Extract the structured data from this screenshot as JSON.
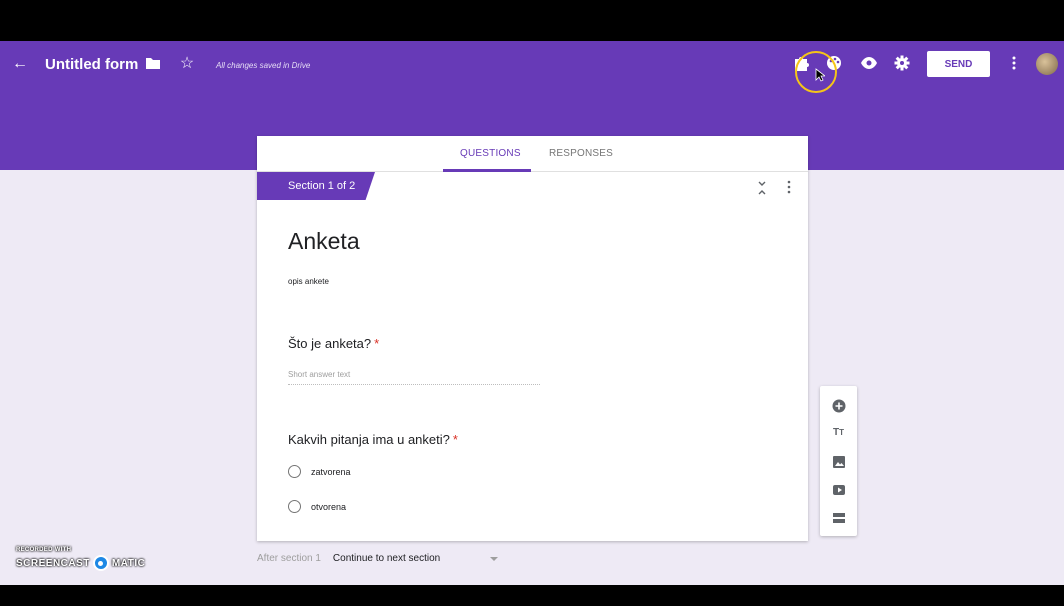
{
  "header": {
    "title": "Untitled form",
    "save_status": "All changes saved in Drive",
    "send_label": "SEND",
    "brand_color": "#673ab7",
    "icons": [
      "back-arrow-icon",
      "folder-icon",
      "star-icon",
      "addon-puzzle-icon",
      "palette-icon",
      "preview-eye-icon",
      "settings-gear-icon",
      "more-vert-icon",
      "avatar"
    ]
  },
  "tabs": [
    {
      "label": "QUESTIONS",
      "active": true
    },
    {
      "label": "RESPONSES",
      "active": false
    }
  ],
  "section": {
    "label": "Section 1 of 2",
    "title": "Anketa",
    "description": "opis ankete"
  },
  "questions": [
    {
      "title": "Što je anketa?",
      "required_mark": "*",
      "placeholder": "Short answer text"
    },
    {
      "title": "Kakvih pitanja ima u anketi?",
      "required_mark": "*",
      "options": [
        "zatvorena",
        "otvorena"
      ]
    }
  ],
  "toolbox": [
    "add-question-icon",
    "add-title-icon",
    "add-image-icon",
    "add-video-icon",
    "add-section-icon"
  ],
  "after_section": {
    "label": "After section 1",
    "value": "Continue to next section"
  },
  "watermark": {
    "top": "RECORDED WITH",
    "left": "SCREENCAST",
    "right": "MATIC"
  }
}
